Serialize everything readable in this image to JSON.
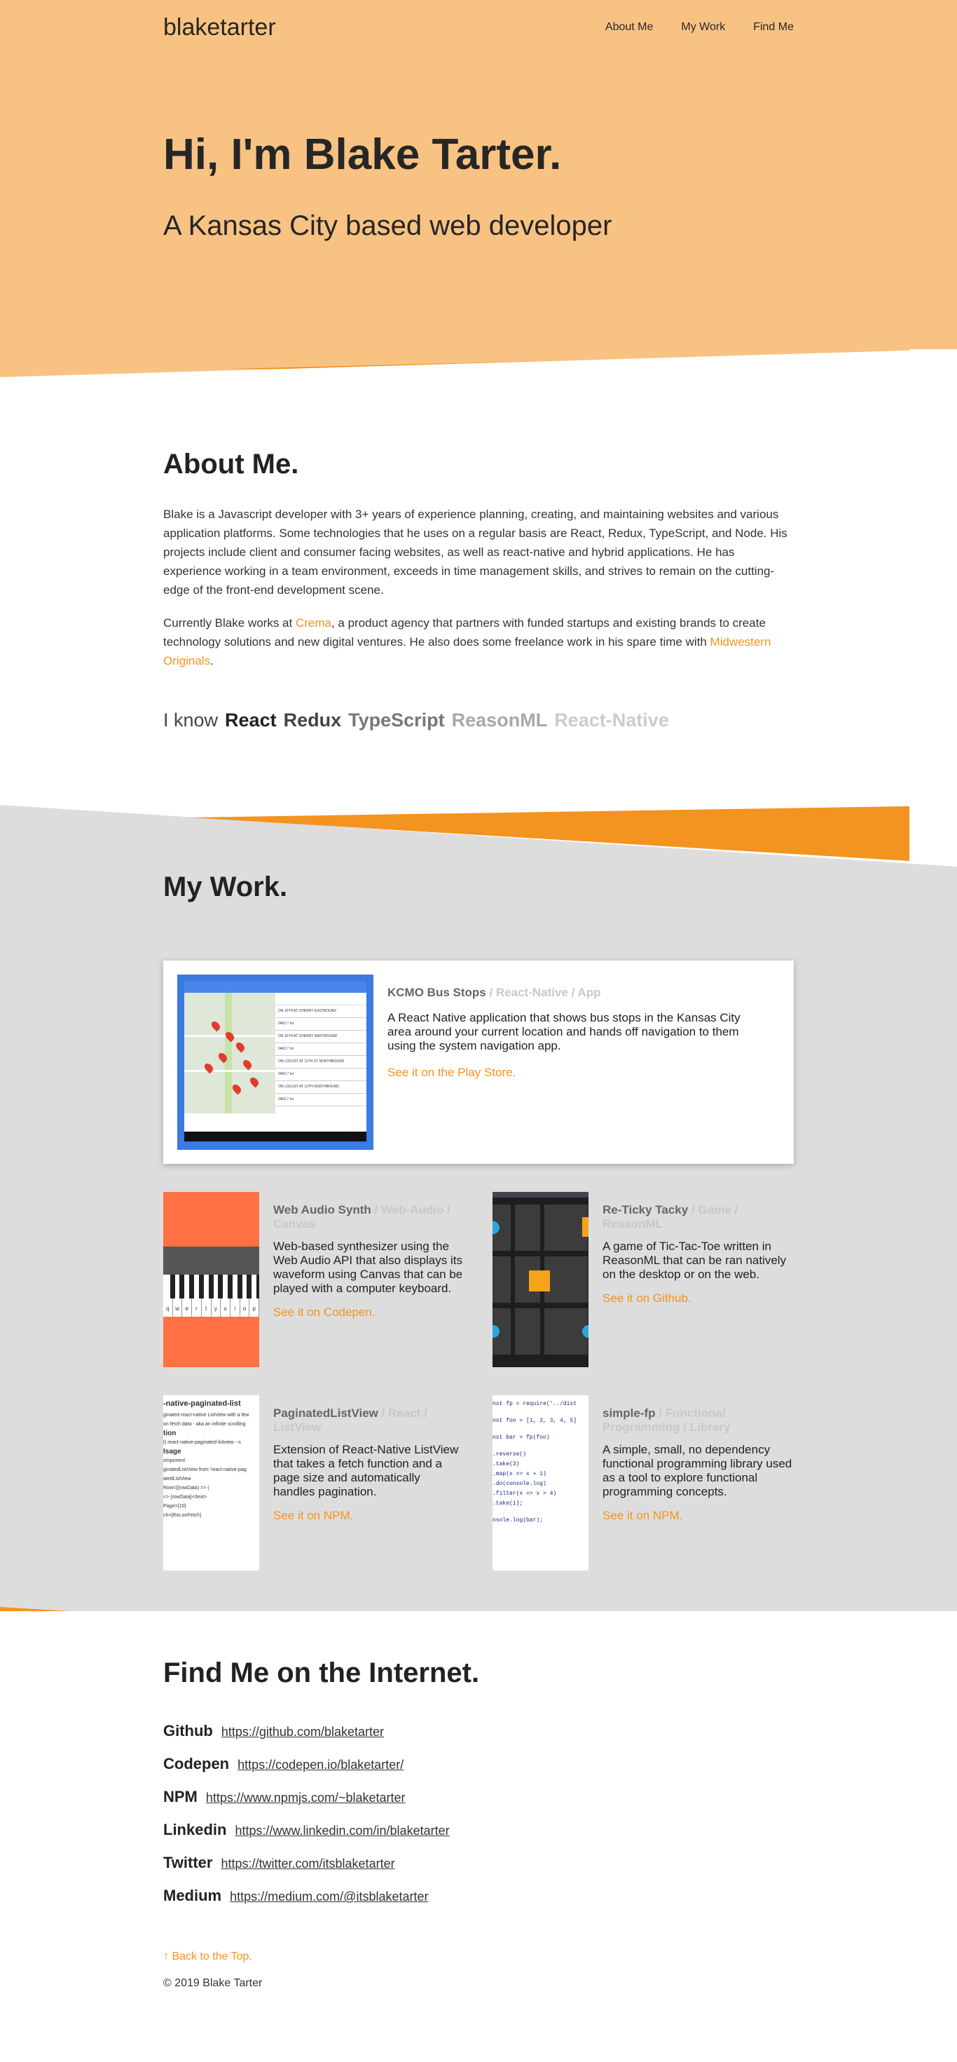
{
  "nav": {
    "brand": "blaketarter",
    "links": [
      "About Me",
      "My Work",
      "Find Me"
    ]
  },
  "hero": {
    "title": "Hi, I'm Blake Tarter.",
    "subtitle": "A Kansas City based web developer"
  },
  "about": {
    "heading": "About Me.",
    "paragraph1": "Blake is a Javascript developer with 3+ years of experience planning, creating, and maintaining websites and various application platforms. Some technologies that he uses on a regular basis are React, Redux, TypeScript, and Node. His projects include client and consumer facing websites, as well as react-native and hybrid applications. He has experience working in a team environment, exceeds in time management skills, and strives to remain on the cutting-edge of the front-end development scene.",
    "p2_before": "Currently Blake works at ",
    "p2_link1": "Crema",
    "p2_middle": ", a product agency that partners with funded startups and existing brands to create technology solutions and new digital ventures. He also does some freelance work in his spare time with ",
    "p2_link2": "Midwestern Originals",
    "p2_after": ".",
    "know_label": "I know",
    "skills": [
      {
        "name": "React",
        "color": "#222222"
      },
      {
        "name": "Redux",
        "color": "#444444"
      },
      {
        "name": "TypeScript",
        "color": "#777777"
      },
      {
        "name": "ReasonML",
        "color": "#a8a8a8"
      },
      {
        "name": "React-Native",
        "color": "#cccccc"
      }
    ]
  },
  "work": {
    "heading": "My Work.",
    "featured": {
      "title": "KCMO Bus Stops",
      "tags": " / React-Native / App",
      "description": "A React Native application that shows bus stops in the Kansas City area around your current location and hands off navigation to them using the system navigation app.",
      "link": "See it on the Play Store.",
      "screen_rows": [
        "ON 10TH AT CHERRY EASTBOUND",
        "0462.7 mi",
        "ON 10TH AT CHERRY WESTBOUND",
        "0462.7 mi",
        "ON LOCUST AT 11TH ST NORTHBOUND",
        "0462.7 mi",
        "ON LOCUST AT 12TH NORTHBOUND",
        "0462.7 mi"
      ]
    },
    "projects": [
      {
        "title": "Web Audio Synth",
        "tags": " / Web-Audio / Canvas",
        "description": "Web-based synthesizer using the Web Audio API that also displays its waveform using Canvas that can be played with a computer keyboard.",
        "link": "See it on Codepen."
      },
      {
        "title": "Re-Ticky Tacky",
        "tags": " / Game / ReasonML",
        "description": "A game of Tic-Tac-Toe written in ReasonML that can be ran natively on the desktop or on the web.",
        "link": "See it on Github."
      },
      {
        "title": "PaginatedListView",
        "tags": " / React / ListView",
        "description": "Extension of React-Native ListView that takes a fetch function and a page size and automatically handles pagination.",
        "link": "See it on NPM."
      },
      {
        "title": "simple-fp",
        "tags": " / Functional Programming / Library",
        "description": "A simple, small, no dependency functional programming library used as a tool to explore functional programming concepts.",
        "link": "See it on NPM."
      }
    ],
    "synth_keys": "qwertyuiop",
    "npm_doc_lines": [
      "-native-paginated-list",
      "ginated react-native ListView with a few",
      "on fetch data - aka an infinite scrolling",
      "tion",
      "t) react-native-paginated-listview --s",
      "Isage",
      "omponent",
      "ginatedListView from 'react-native-pag",
      "atedListView",
      "Row={(rowData) => (",
      "<> {rowData}</text>",
      "Page={10}",
      "ch={this.onFetch}"
    ],
    "code_lines": [
      "nst fp = require('../dist",
      "nst foo = [1, 2, 3, 4, 5]",
      "nst bar = fp(foo)",
      ".reverse()",
      ".take(3)",
      ".map(x => x + 1)",
      ".do(console.log)",
      ".filter(x => x > 4)",
      ".take(1);",
      "nsole.log(bar);"
    ]
  },
  "find": {
    "heading": "Find Me on the Internet.",
    "links": [
      {
        "name": "Github",
        "url": "https://github.com/blaketarter"
      },
      {
        "name": "Codepen",
        "url": "https://codepen.io/blaketarter/"
      },
      {
        "name": "NPM",
        "url": "https://www.npmjs.com/~blaketarter"
      },
      {
        "name": "Linkedin",
        "url": "https://www.linkedin.com/in/blaketarter"
      },
      {
        "name": "Twitter",
        "url": "https://twitter.com/itsblaketarter"
      },
      {
        "name": "Medium",
        "url": "https://medium.com/@itsblaketarter"
      }
    ],
    "back_to_top": "↑ Back to the Top.",
    "copyright": "© 2019 Blake Tarter"
  },
  "colors": {
    "hero_bg": "#f8c283",
    "accent": "#f39320",
    "work_bg": "#dddddd"
  }
}
